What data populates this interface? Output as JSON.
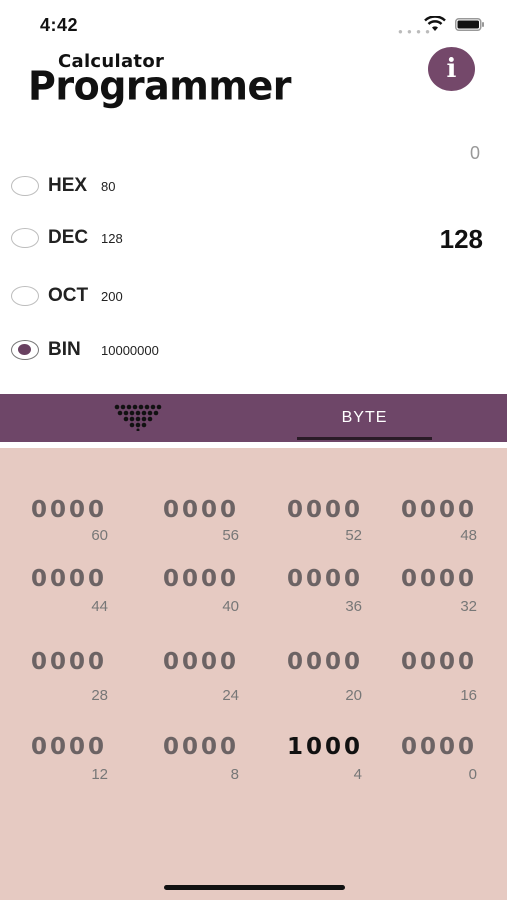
{
  "status": {
    "time": "4:42"
  },
  "header": {
    "subtitle": "Calculator",
    "title": "Programmer",
    "info_label": "i"
  },
  "display": {
    "top_value": "0",
    "big_value": "128"
  },
  "bases": [
    {
      "label": "HEX",
      "value": "80",
      "selected": false
    },
    {
      "label": "DEC",
      "value": "128",
      "selected": false
    },
    {
      "label": "OCT",
      "value": "200",
      "selected": false
    },
    {
      "label": "BIN",
      "value": "10000000",
      "selected": true
    }
  ],
  "tabs": {
    "byte_label": "BYTE",
    "keypad_icon": "triangle-dots-icon"
  },
  "bits": [
    {
      "nibble": "0000",
      "index": "60"
    },
    {
      "nibble": "0000",
      "index": "56"
    },
    {
      "nibble": "0000",
      "index": "52"
    },
    {
      "nibble": "0000",
      "index": "48"
    },
    {
      "nibble": "0000",
      "index": "44"
    },
    {
      "nibble": "0000",
      "index": "40"
    },
    {
      "nibble": "0000",
      "index": "36"
    },
    {
      "nibble": "0000",
      "index": "32"
    },
    {
      "nibble": "0000",
      "index": "28"
    },
    {
      "nibble": "0000",
      "index": "24"
    },
    {
      "nibble": "0000",
      "index": "20"
    },
    {
      "nibble": "0000",
      "index": "16"
    },
    {
      "nibble": "0000",
      "index": "12"
    },
    {
      "nibble": "0000",
      "index": "8"
    },
    {
      "nibble": "1000",
      "index": "4"
    },
    {
      "nibble": "0000",
      "index": "0"
    }
  ],
  "colors": {
    "accent": "#6e4668",
    "panel": "#e6cac2"
  }
}
